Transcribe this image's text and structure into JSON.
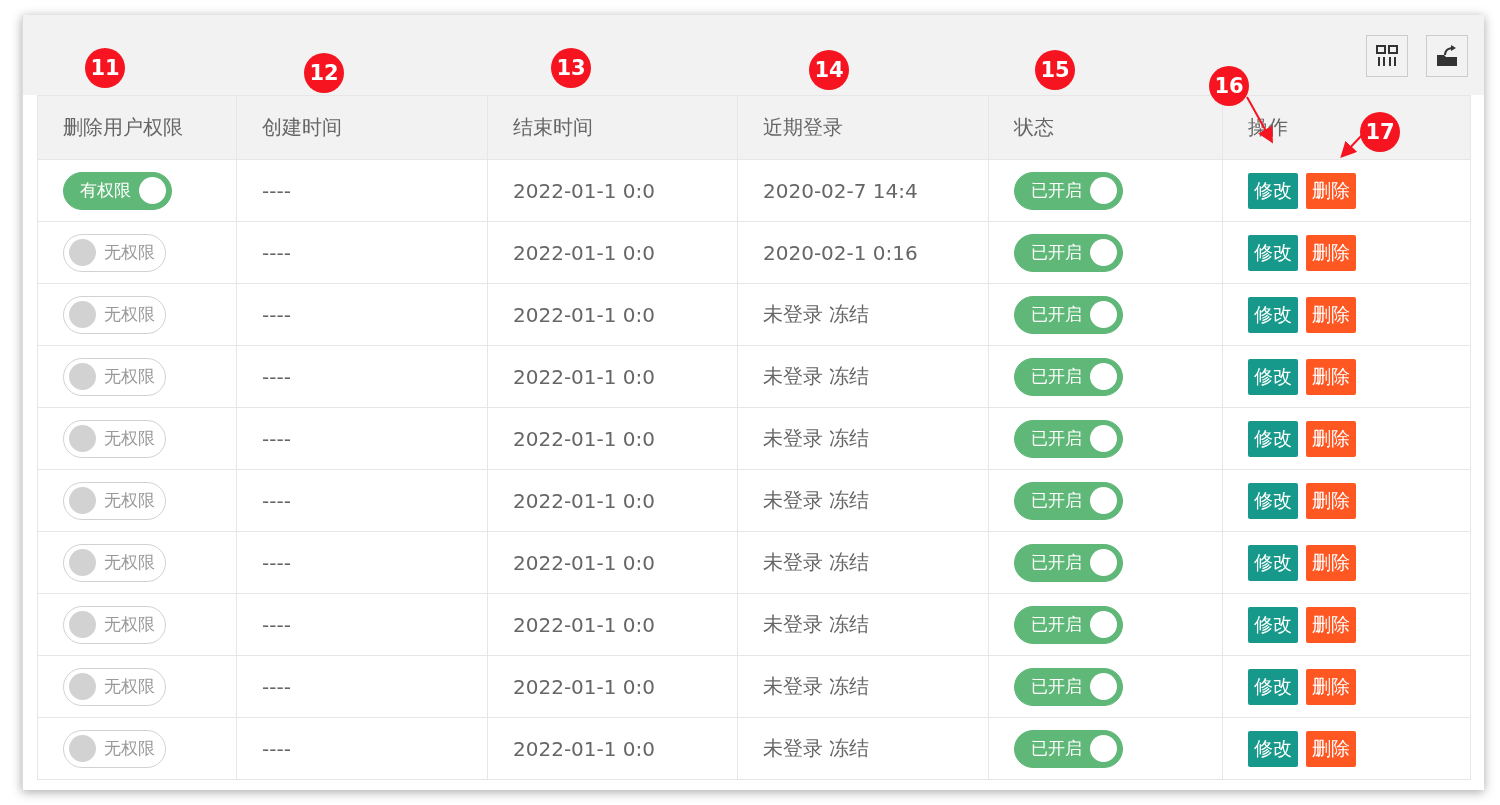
{
  "toolbar": {
    "buttons": [
      {
        "kind": "columns"
      },
      {
        "kind": "export"
      }
    ]
  },
  "table": {
    "columns": [
      "删除用户权限",
      "创建时间",
      "结束时间",
      "近期登录",
      "状态",
      "操作"
    ],
    "rows": [
      {
        "permission": {
          "label": "有权限",
          "on": true
        },
        "created": "----",
        "end": "2022-01-1 0:0",
        "last_login": "2020-02-7 14:4",
        "status": {
          "label": "已开启",
          "on": true
        },
        "actions": [
          "修改",
          "删除"
        ]
      },
      {
        "permission": {
          "label": "无权限",
          "on": false
        },
        "created": "----",
        "end": "2022-01-1 0:0",
        "last_login": "2020-02-1 0:16",
        "status": {
          "label": "已开启",
          "on": true
        },
        "actions": [
          "修改",
          "删除"
        ]
      },
      {
        "permission": {
          "label": "无权限",
          "on": false
        },
        "created": "----",
        "end": "2022-01-1 0:0",
        "last_login": "未登录 冻结",
        "status": {
          "label": "已开启",
          "on": true
        },
        "actions": [
          "修改",
          "删除"
        ]
      },
      {
        "permission": {
          "label": "无权限",
          "on": false
        },
        "created": "----",
        "end": "2022-01-1 0:0",
        "last_login": "未登录 冻结",
        "status": {
          "label": "已开启",
          "on": true
        },
        "actions": [
          "修改",
          "删除"
        ]
      },
      {
        "permission": {
          "label": "无权限",
          "on": false
        },
        "created": "----",
        "end": "2022-01-1 0:0",
        "last_login": "未登录 冻结",
        "status": {
          "label": "已开启",
          "on": true
        },
        "actions": [
          "修改",
          "删除"
        ]
      },
      {
        "permission": {
          "label": "无权限",
          "on": false
        },
        "created": "----",
        "end": "2022-01-1 0:0",
        "last_login": "未登录 冻结",
        "status": {
          "label": "已开启",
          "on": true
        },
        "actions": [
          "修改",
          "删除"
        ]
      },
      {
        "permission": {
          "label": "无权限",
          "on": false
        },
        "created": "----",
        "end": "2022-01-1 0:0",
        "last_login": "未登录 冻结",
        "status": {
          "label": "已开启",
          "on": true
        },
        "actions": [
          "修改",
          "删除"
        ]
      },
      {
        "permission": {
          "label": "无权限",
          "on": false
        },
        "created": "----",
        "end": "2022-01-1 0:0",
        "last_login": "未登录 冻结",
        "status": {
          "label": "已开启",
          "on": true
        },
        "actions": [
          "修改",
          "删除"
        ]
      },
      {
        "permission": {
          "label": "无权限",
          "on": false
        },
        "created": "----",
        "end": "2022-01-1 0:0",
        "last_login": "未登录 冻结",
        "status": {
          "label": "已开启",
          "on": true
        },
        "actions": [
          "修改",
          "删除"
        ]
      },
      {
        "permission": {
          "label": "无权限",
          "on": false
        },
        "created": "----",
        "end": "2022-01-1 0:0",
        "last_login": "未登录 冻结",
        "status": {
          "label": "已开启",
          "on": true
        },
        "actions": [
          "修改",
          "删除"
        ]
      }
    ]
  },
  "annotations": [
    {
      "label": "11",
      "kind": "marker"
    },
    {
      "label": "12",
      "kind": "marker"
    },
    {
      "label": "13",
      "kind": "marker"
    },
    {
      "label": "14",
      "kind": "marker"
    },
    {
      "label": "15",
      "kind": "marker"
    },
    {
      "label": "16",
      "kind": "pointer"
    },
    {
      "label": "17",
      "kind": "pointer"
    }
  ]
}
